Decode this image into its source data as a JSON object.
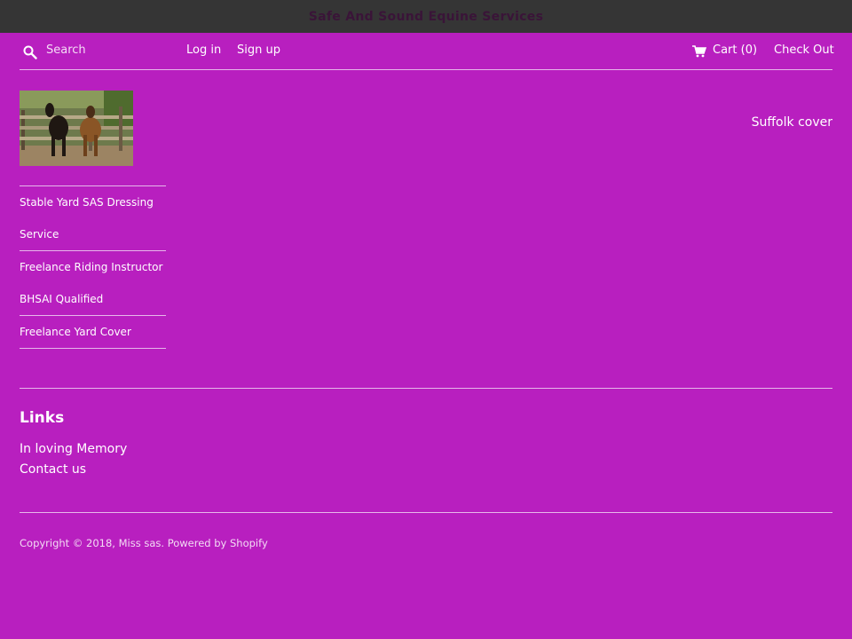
{
  "announcement": {
    "text": "Safe And Sound Equine Services"
  },
  "header": {
    "search_placeholder": "Search",
    "login": "Log in",
    "signup": "Sign up",
    "cart": "Cart (0)",
    "checkout": "Check Out"
  },
  "sidebar": {
    "items": [
      {
        "lines": [
          "Stable Yard SAS Dressing",
          "Service"
        ]
      },
      {
        "lines": [
          "Freelance Riding Instructor",
          "BHSAI Qualified"
        ]
      },
      {
        "lines": [
          "Freelance Yard Cover"
        ]
      }
    ]
  },
  "main": {
    "heading": "Suffolk cover"
  },
  "footer": {
    "links_title": "Links",
    "links": [
      "In loving Memory",
      "Contact us"
    ],
    "copyright_prefix": "Copyright © 2018, ",
    "copyright_owner": "Miss sas",
    "copyright_powered": ". Powered by Shopify"
  },
  "colors": {
    "background": "#b81fbf",
    "announcement_bg": "#353535",
    "announcement_text": "#3a1438",
    "divider": "#e7b8ea"
  },
  "icons": {
    "search": "search-icon",
    "cart": "cart-icon"
  }
}
